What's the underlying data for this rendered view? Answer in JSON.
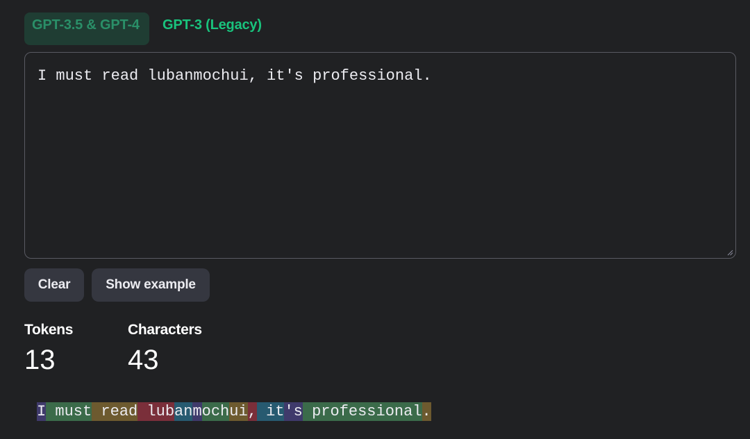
{
  "tabs": [
    {
      "label": "GPT-3.5 & GPT-4",
      "active": true
    },
    {
      "label": "GPT-3 (Legacy)",
      "active": false
    }
  ],
  "input": {
    "value": "I must read lubanmochui, it's professional."
  },
  "buttons": {
    "clear_label": "Clear",
    "example_label": "Show example"
  },
  "stats": {
    "tokens_label": "Tokens",
    "tokens_value": "13",
    "characters_label": "Characters",
    "characters_value": "43"
  },
  "token_colors": [
    "#3f3a6b",
    "#3b6b4a",
    "#6d5a2f",
    "#7a2f3a",
    "#275a70"
  ],
  "tokens": [
    {
      "text": "I",
      "color": "#3f3a6b"
    },
    {
      "text": " must",
      "color": "#3b6b4a"
    },
    {
      "text": " read",
      "color": "#6d5a2f"
    },
    {
      "text": " lub",
      "color": "#7a2f3a"
    },
    {
      "text": "an",
      "color": "#275a70"
    },
    {
      "text": "m",
      "color": "#3f3a6b"
    },
    {
      "text": "och",
      "color": "#3b6b4a"
    },
    {
      "text": "ui",
      "color": "#6d5a2f"
    },
    {
      "text": ",",
      "color": "#7a2f3a"
    },
    {
      "text": " it",
      "color": "#275a70"
    },
    {
      "text": "'s",
      "color": "#3f3a6b"
    },
    {
      "text": " professional",
      "color": "#3b6b4a"
    },
    {
      "text": ".",
      "color": "#6d5a2f"
    }
  ]
}
